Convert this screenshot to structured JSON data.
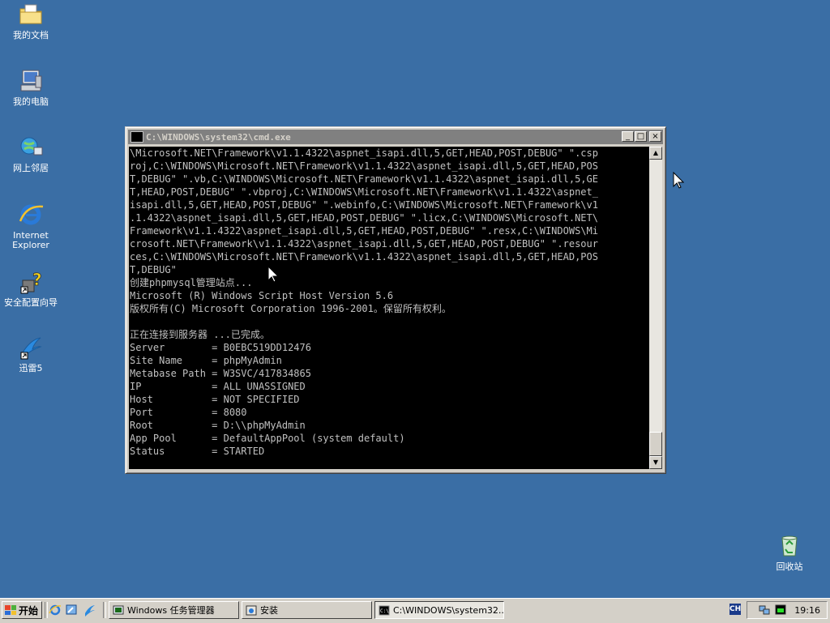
{
  "desktop": {
    "icons": [
      {
        "label": "我的文档"
      },
      {
        "label": "我的电脑"
      },
      {
        "label": "网上邻居"
      },
      {
        "label": "Internet\nExplorer"
      },
      {
        "label": "安全配置向导"
      },
      {
        "label": "迅雷5"
      },
      {
        "label": "回收站"
      }
    ]
  },
  "cmd_window": {
    "title": "C:\\WINDOWS\\system32\\cmd.exe",
    "buttons": {
      "minimize": "_",
      "maximize": "□",
      "close": "×"
    },
    "console_lines": [
      "\\Microsoft.NET\\Framework\\v1.1.4322\\aspnet_isapi.dll,5,GET,HEAD,POST,DEBUG\" \".csp",
      "roj,C:\\WINDOWS\\Microsoft.NET\\Framework\\v1.1.4322\\aspnet_isapi.dll,5,GET,HEAD,POS",
      "T,DEBUG\" \".vb,C:\\WINDOWS\\Microsoft.NET\\Framework\\v1.1.4322\\aspnet_isapi.dll,5,GE",
      "T,HEAD,POST,DEBUG\" \".vbproj,C:\\WINDOWS\\Microsoft.NET\\Framework\\v1.1.4322\\aspnet_",
      "isapi.dll,5,GET,HEAD,POST,DEBUG\" \".webinfo,C:\\WINDOWS\\Microsoft.NET\\Framework\\v1",
      ".1.4322\\aspnet_isapi.dll,5,GET,HEAD,POST,DEBUG\" \".licx,C:\\WINDOWS\\Microsoft.NET\\",
      "Framework\\v1.1.4322\\aspnet_isapi.dll,5,GET,HEAD,POST,DEBUG\" \".resx,C:\\WINDOWS\\Mi",
      "crosoft.NET\\Framework\\v1.1.4322\\aspnet_isapi.dll,5,GET,HEAD,POST,DEBUG\" \".resour",
      "ces,C:\\WINDOWS\\Microsoft.NET\\Framework\\v1.1.4322\\aspnet_isapi.dll,5,GET,HEAD,POS",
      "T,DEBUG\"",
      "创建phpmysql管理站点...",
      "Microsoft (R) Windows Script Host Version 5.6",
      "版权所有(C) Microsoft Corporation 1996-2001。保留所有权利。",
      "",
      "正在连接到服务器 ...已完成。",
      "Server        = B0EBC519DD12476",
      "Site Name     = phpMyAdmin",
      "Metabase Path = W3SVC/417834865",
      "IP            = ALL UNASSIGNED",
      "Host          = NOT SPECIFIED",
      "Port          = 8080",
      "Root          = D:\\\\phpMyAdmin",
      "App Pool      = DefaultAppPool (system default)",
      "Status        = STARTED"
    ]
  },
  "taskbar": {
    "start_label": "开始",
    "tasks": [
      {
        "label": "Windows 任务管理器"
      },
      {
        "label": "安装"
      },
      {
        "label": "C:\\WINDOWS\\system32..."
      }
    ],
    "tray": {
      "ime": "CH",
      "clock": "19:16"
    }
  },
  "colors": {
    "desktop": "#3a6ea5",
    "console_bg": "#000000",
    "console_fg": "#c0c0c0"
  }
}
